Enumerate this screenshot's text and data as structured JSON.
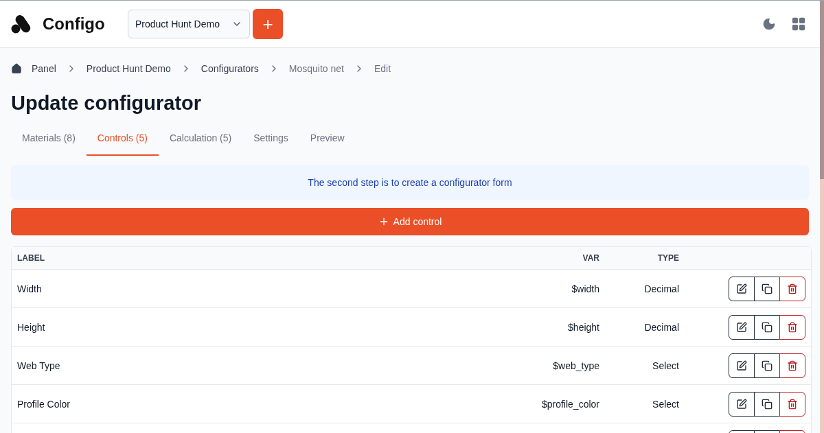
{
  "brand": {
    "name": "Configo"
  },
  "project_select": {
    "value": "Product Hunt Demo"
  },
  "add_project_button": {
    "label": "+"
  },
  "breadcrumbs": [
    {
      "label": "Panel",
      "kind": "home"
    },
    {
      "label": "Product Hunt Demo",
      "kind": "link"
    },
    {
      "label": "Configurators",
      "kind": "link"
    },
    {
      "label": "Mosquito net",
      "kind": "muted"
    },
    {
      "label": "Edit",
      "kind": "muted"
    }
  ],
  "title": "Update configurator",
  "tabs": [
    {
      "label": "Materials (8)",
      "selected": false
    },
    {
      "label": "Controls (5)",
      "selected": true
    },
    {
      "label": "Calculation (5)",
      "selected": false
    },
    {
      "label": "Settings",
      "selected": false
    },
    {
      "label": "Preview",
      "selected": false
    }
  ],
  "info": "The second step is to create a configurator form",
  "add_button": {
    "label": "Add control"
  },
  "table": {
    "columns": [
      "LABEL",
      "VAR",
      "TYPE"
    ],
    "rows": [
      {
        "label": "Width",
        "var": "$width",
        "type": "Decimal"
      },
      {
        "label": "Height",
        "var": "$height",
        "type": "Decimal"
      },
      {
        "label": "Web Type",
        "var": "$web_type",
        "type": "Select"
      },
      {
        "label": "Profile Color",
        "var": "$profile_color",
        "type": "Select"
      },
      {
        "partial": true
      }
    ]
  }
}
